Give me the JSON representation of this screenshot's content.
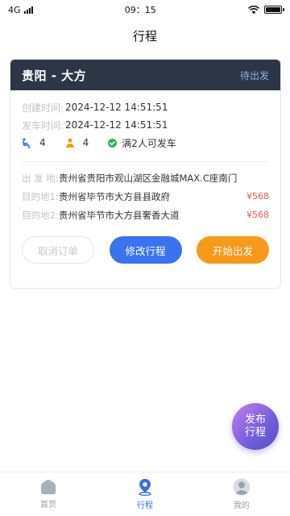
{
  "status_bar": {
    "network": "4G",
    "time": "09：15"
  },
  "page_title": "行程",
  "trip": {
    "route": "贵阳  -  大方",
    "status": "待出发",
    "created_label": "创建时间:",
    "created_value": "2024-12-12  14:51:51",
    "depart_label": "发车时间:",
    "depart_value": "2024-12-12  14:51:51",
    "seats": "4",
    "passengers": "4",
    "rule": "满2人可发车",
    "origin_label": "出 发 地:",
    "origin_value": "贵州省贵阳市观山湖区金融城MAX.C座南门",
    "dest1_label": "目的地1:",
    "dest1_value": "贵州省毕节市大方县县政府",
    "dest1_price": "¥568",
    "dest2_label": "目的地2:",
    "dest2_value": "贵州省毕节市大方县奢香大道",
    "dest2_price": "¥568"
  },
  "buttons": {
    "cancel": "取消订单",
    "edit": "修改行程",
    "start": "开始出发"
  },
  "fab": {
    "line1": "发布",
    "line2": "行程"
  },
  "tabs": [
    {
      "label": "首页",
      "icon": "home-icon"
    },
    {
      "label": "行程",
      "icon": "location-pin-icon"
    },
    {
      "label": "我的",
      "icon": "user-icon"
    }
  ],
  "colors": {
    "header_bg": "#2c3646",
    "accent_blue": "#3a72f0",
    "accent_orange": "#f59a1b",
    "price_red": "#e05a4e",
    "battery_level": 1.0
  }
}
